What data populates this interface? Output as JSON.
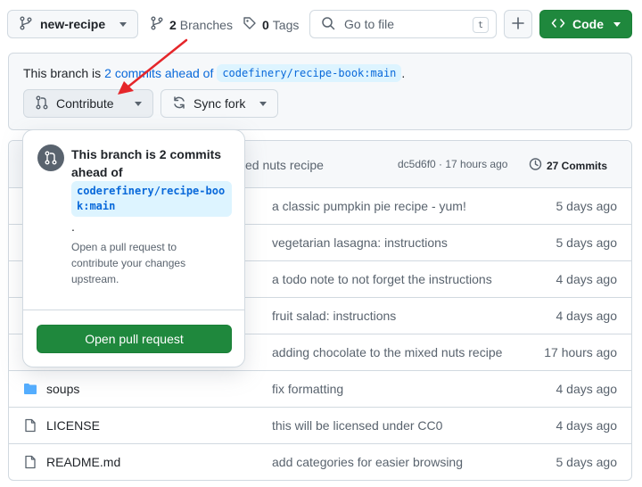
{
  "topbar": {
    "branch_name": "new-recipe",
    "branches_count": "2",
    "branches_label": "Branches",
    "tags_count": "0",
    "tags_label": "Tags",
    "search_placeholder": "Go to file",
    "search_shortcut": "t",
    "code_label": "Code"
  },
  "notice": {
    "prefix": "This branch is",
    "link": "2 commits ahead of",
    "ref": "codefinery/recipe-book:main",
    "suffix": ".",
    "contribute_label": "Contribute",
    "sync_label": "Sync fork"
  },
  "popover": {
    "title": "This branch is 2 commits ahead of",
    "ref": "coderefinery/recipe-book:main",
    "dot": ".",
    "description": "Open a pull request to contribute your changes upstream.",
    "button_label": "Open pull request"
  },
  "latest_commit": {
    "message": "xed nuts recipe",
    "hash_time": "dc5d6f0 · 17 hours ago",
    "commits_count": "27 Commits"
  },
  "files": [
    {
      "name": "",
      "type": "dir",
      "message": "a classic pumpkin pie recipe - yum!",
      "date": "5 days ago"
    },
    {
      "name": "",
      "type": "dir",
      "message": "vegetarian lasagna: instructions",
      "date": "5 days ago"
    },
    {
      "name": "",
      "type": "dir",
      "message": "a todo note to not forget the instructions",
      "date": "4 days ago"
    },
    {
      "name": "",
      "type": "dir",
      "message": "fruit salad: instructions",
      "date": "4 days ago"
    },
    {
      "name": "",
      "type": "dir",
      "message": "adding chocolate to the mixed nuts recipe",
      "date": "17 hours ago"
    },
    {
      "name": "soups",
      "type": "dir",
      "message": "fix formatting",
      "date": "4 days ago"
    },
    {
      "name": "LICENSE",
      "type": "file",
      "message": "this will be licensed under CC0",
      "date": "4 days ago"
    },
    {
      "name": "README.md",
      "type": "file",
      "message": "add categories for easier browsing",
      "date": "5 days ago"
    }
  ],
  "colors": {
    "primary_green": "#1f883d",
    "link_blue": "#0969da",
    "annotation_red": "#e5262a"
  }
}
